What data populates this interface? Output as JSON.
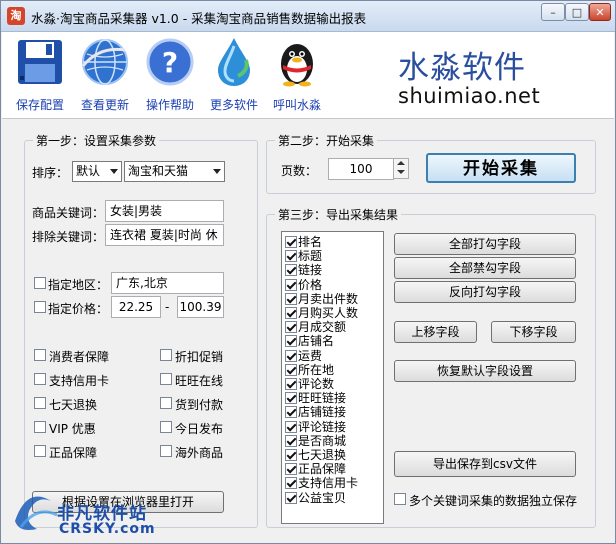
{
  "window": {
    "title": "水淼·淘宝商品采集器 v1.0 - 采集淘宝商品销售数据输出报表",
    "icon_label": "淘",
    "min": "–",
    "max": "□",
    "close": "✕"
  },
  "toolbar": {
    "items": [
      {
        "label": "保存配置",
        "icon": "floppy-disk-icon"
      },
      {
        "label": "查看更新",
        "icon": "globe-icon"
      },
      {
        "label": "操作帮助",
        "icon": "help-icon"
      },
      {
        "label": "更多软件",
        "icon": "water-drop-icon"
      },
      {
        "label": "呼叫水淼",
        "icon": "qq-penguin-icon"
      }
    ],
    "brand_cn": "水淼软件",
    "brand_en": "shuimiao.net"
  },
  "step1": {
    "legend": "第一步：设置采集参数",
    "sort_label": "排序：",
    "sort_value": "默认",
    "scope_value": "淘宝和天猫",
    "keyword_label": "商品关键词：",
    "keyword_value": "女装|男装",
    "exclude_label": "排除关键词：",
    "exclude_value": "连衣裙 夏装|时尚 休",
    "region": {
      "label": "指定地区：",
      "checked": false,
      "value": "广东,北京"
    },
    "price": {
      "label": "指定价格：",
      "checked": false,
      "min": "22.25",
      "sep": "-",
      "max": "100.39"
    },
    "options": [
      {
        "label": "消费者保障",
        "checked": false
      },
      {
        "label": "折扣促销",
        "checked": false
      },
      {
        "label": "支持信用卡",
        "checked": false
      },
      {
        "label": "旺旺在线",
        "checked": false
      },
      {
        "label": "七天退换",
        "checked": false
      },
      {
        "label": "货到付款",
        "checked": false
      },
      {
        "label": "VIP 优惠",
        "checked": false
      },
      {
        "label": "今日发布",
        "checked": false
      },
      {
        "label": "正品保障",
        "checked": false
      },
      {
        "label": "海外商品",
        "checked": false
      }
    ],
    "browser_button": "根据设置在浏览器里打开"
  },
  "step2": {
    "legend": "第二步：开始采集",
    "pages_label": "页数：",
    "pages_value": "100",
    "start_button": "开始采集"
  },
  "step3": {
    "legend": "第三步：导出采集结果",
    "fields": [
      "排名",
      "标题",
      "链接",
      "价格",
      "月卖出件数",
      "月购买人数",
      "月成交额",
      "店铺名",
      "运费",
      "所在地",
      "评论数",
      "旺旺链接",
      "店铺链接",
      "评论链接",
      "是否商城",
      "七天退换",
      "正品保障",
      "支持信用卡",
      "公益宝贝"
    ],
    "btn_check_all": "全部打勾字段",
    "btn_uncheck_all": "全部禁勾字段",
    "btn_invert": "反向打勾字段",
    "btn_up": "上移字段",
    "btn_down": "下移字段",
    "btn_restore": "恢复默认字段设置",
    "btn_export": "导出保存到csv文件",
    "separate_label": "多个关键词采集的数据独立保存",
    "separate_checked": false
  },
  "watermark": {
    "cn": "非凡软件站",
    "en": "CRSKY.com"
  }
}
